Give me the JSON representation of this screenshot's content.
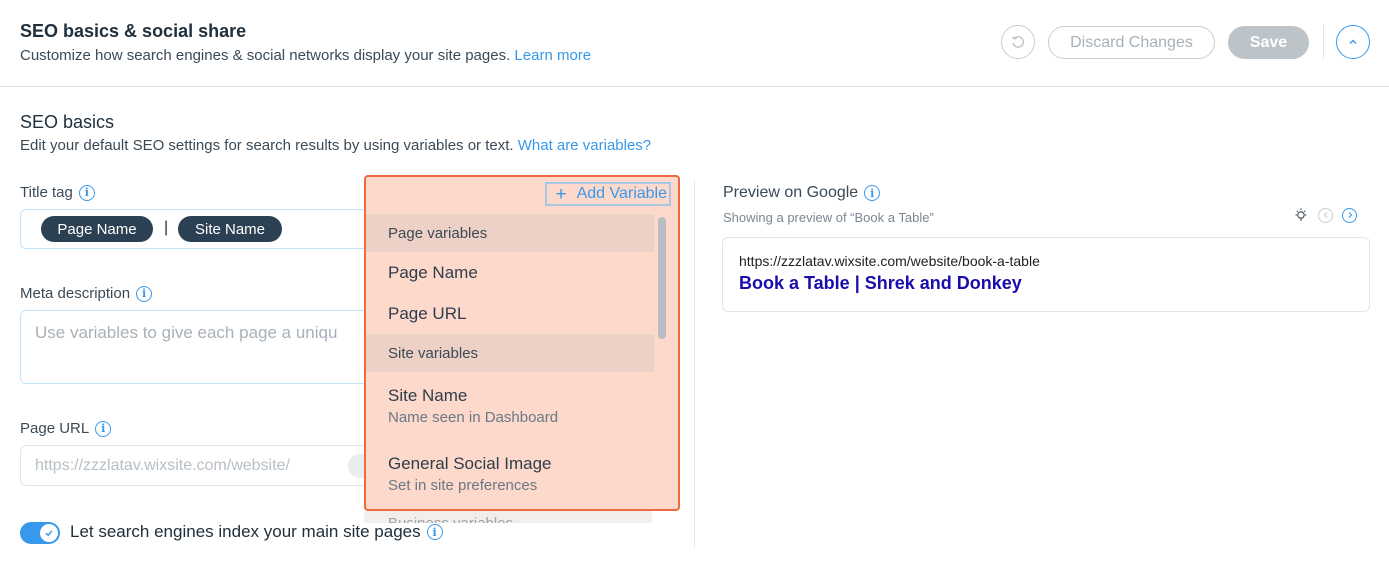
{
  "header": {
    "title": "SEO basics & social share",
    "subtitle": "Customize how search engines & social networks display your site pages.",
    "learn_more": "Learn more",
    "discard_label": "Discard Changes",
    "save_label": "Save"
  },
  "seo_basics": {
    "title": "SEO basics",
    "subtitle": "Edit your default SEO settings for search results by using variables or text.",
    "variables_link": "What are variables?"
  },
  "title_tag": {
    "label": "Title tag",
    "chips": [
      "Page Name",
      "Site Name"
    ],
    "separator": "|"
  },
  "meta_description": {
    "label": "Meta description",
    "placeholder": "Use variables to give each page a uniqu"
  },
  "page_url": {
    "label": "Page URL",
    "value": "https://zzzlatav.wixsite.com/website/"
  },
  "index_toggle": {
    "label": "Let search engines index your main site pages",
    "checked": true
  },
  "dropdown": {
    "add_variable": "Add Variable",
    "groups": [
      {
        "header": "Page variables",
        "items": [
          {
            "label": "Page Name"
          },
          {
            "label": "Page URL"
          }
        ]
      },
      {
        "header": "Site variables",
        "items": [
          {
            "label": "Site Name",
            "sub": "Name seen in Dashboard"
          },
          {
            "label": "General Social Image",
            "sub": "Set in site preferences"
          }
        ]
      }
    ],
    "next_group_partial": "Business variables"
  },
  "preview": {
    "title": "Preview on Google",
    "subtitle": "Showing a preview of “Book a Table”",
    "url": "https://zzzlatav.wixsite.com/website/book-a-table",
    "link": "Book a Table | Shrek and Donkey"
  },
  "colors": {
    "accent": "#3899ec",
    "dropdown_highlight": "#fdd9cc",
    "dropdown_border": "#f06a40",
    "chip_bg": "#2b4052",
    "google_link": "#1a0dab"
  }
}
